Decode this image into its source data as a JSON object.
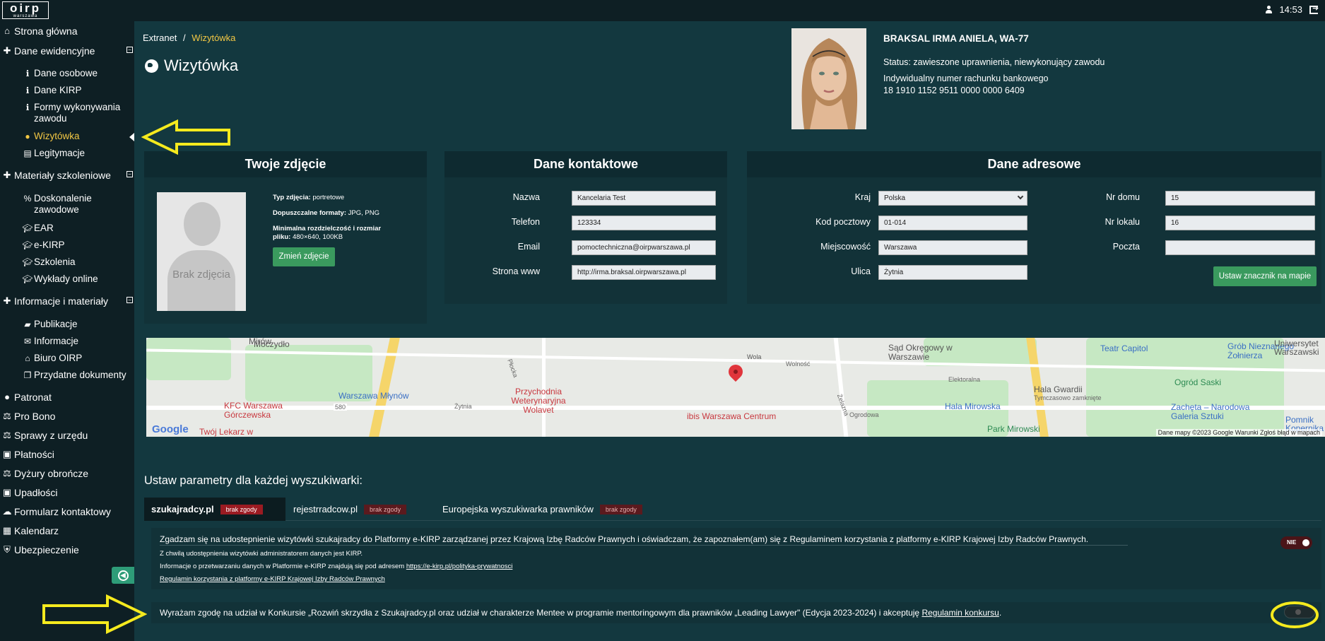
{
  "topbar": {
    "logo_big": "oirp",
    "logo_small": "warszawa",
    "time": "14:53"
  },
  "sidebar": {
    "items": [
      {
        "label": "Strona główna",
        "icon": "home-icon"
      },
      {
        "label": "Dane ewidencyjne",
        "icon": "plus-icon"
      },
      {
        "label": "Dane osobowe",
        "icon": "info-icon"
      },
      {
        "label": "Dane KIRP",
        "icon": "info-icon"
      },
      {
        "label": "Formy wykonywania zawodu",
        "icon": "info-icon"
      },
      {
        "label": "Wizytówka",
        "icon": "globe-icon"
      },
      {
        "label": "Legitymacje",
        "icon": "id-card-icon"
      },
      {
        "label": "Materiały szkoleniowe",
        "icon": "plus-icon"
      },
      {
        "label": "Doskonalenie zawodowe",
        "icon": "link-icon"
      },
      {
        "label": "EAR",
        "icon": "graduation-cap-icon"
      },
      {
        "label": "e-KIRP",
        "icon": "graduation-cap-icon"
      },
      {
        "label": "Szkolenia",
        "icon": "graduation-cap-icon"
      },
      {
        "label": "Wykłady online",
        "icon": "graduation-cap-icon"
      },
      {
        "label": "Informacje i materiały",
        "icon": "plus-icon"
      },
      {
        "label": "Publikacje",
        "icon": "book-icon"
      },
      {
        "label": "Informacje",
        "icon": "envelope-icon"
      },
      {
        "label": "Biuro OIRP",
        "icon": "bank-icon"
      },
      {
        "label": "Przydatne dokumenty",
        "icon": "documents-icon"
      },
      {
        "label": "Patronat",
        "icon": "user-icon"
      },
      {
        "label": "Pro Bono",
        "icon": "scales-icon"
      },
      {
        "label": "Sprawy z urzędu",
        "icon": "scales-icon"
      },
      {
        "label": "Płatności",
        "icon": "money-icon"
      },
      {
        "label": "Dyżury obrończe",
        "icon": "scales-icon"
      },
      {
        "label": "Upadłości",
        "icon": "money-icon"
      },
      {
        "label": "Formularz kontaktowy",
        "icon": "comments-icon"
      },
      {
        "label": "Kalendarz",
        "icon": "calendar-icon"
      },
      {
        "label": "Ubezpieczenie",
        "icon": "shield-icon"
      }
    ]
  },
  "breadcrumb": {
    "root": "Extranet",
    "separator": "/",
    "current": "Wizytówka"
  },
  "page_title": "Wizytówka",
  "profile": {
    "name": "BRAKSAL IRMA ANIELA, WA-77",
    "status": "Status: zawieszone uprawnienia, niewykonujący zawodu",
    "account_label": "Indywidualny numer rachunku bankowego",
    "account_number": "18 1910 1152 9511 0000 0000 6409"
  },
  "photo_panel": {
    "title": "Twoje zdjęcie",
    "no_photo": "Brak zdjęcia",
    "type_label": "Typ zdjęcia:",
    "type_value": "portretowe",
    "formats_label": "Dopuszczalne formaty:",
    "formats_value": "JPG, PNG",
    "min_label": "Minimalna rozdzielczość i rozmiar pliku:",
    "min_value": "480×640, 100KB",
    "button": "Zmień zdjęcie"
  },
  "contact_panel": {
    "title": "Dane kontaktowe",
    "fields": [
      {
        "label": "Nazwa",
        "value": "Kancelaria Test"
      },
      {
        "label": "Telefon",
        "value": "123334"
      },
      {
        "label": "Email",
        "value": "pomoctechniczna@oirpwarszawa.pl"
      },
      {
        "label": "Strona www",
        "value": "http://irma.braksal.oirpwarszawa.pl"
      }
    ]
  },
  "address_panel": {
    "title": "Dane adresowe",
    "country_label": "Kraj",
    "country_value": "Polska",
    "postal_label": "Kod pocztowy",
    "postal_value": "01-014",
    "city_label": "Miejscowość",
    "city_value": "Warszawa",
    "street_label": "Ulica",
    "street_value": "Żytnia",
    "house_label": "Nr domu",
    "house_value": "15",
    "flat_label": "Nr lokalu",
    "flat_value": "16",
    "post_label": "Poczta",
    "post_value": "",
    "button": "Ustaw znacznik na mapie"
  },
  "map": {
    "labels": [
      "Mirów",
      "Wola",
      "Moczydło",
      "Warszawa Młynów",
      "Przychodnia Weterynaryjna Wolavet",
      "KFC Warszawa Górczewska",
      "Twój Lekarz w",
      "ibis Warszawa Centrum",
      "Sąd Okręgowy w Warszawie",
      "Teatr Capitol",
      "Grób Nieznanego Żołnierza",
      "Hala Gwardii",
      "Tymczasowo zamknięte",
      "Hala Mirowska",
      "Ogród Saski",
      "Zachęta – Narodowa Galeria Sztuki",
      "Park Mirowski",
      "Uniwersytet Warszawski",
      "Pomnik Kopernika",
      "Żytnia",
      "Elektoralna",
      "Żelazna",
      "Płocka",
      "Ogrodowa",
      "Wolność",
      "580"
    ],
    "google": "Google",
    "footer": "Dane mapy ©2023 Google   Warunki   Zgłoś błąd w mapach"
  },
  "search": {
    "title": "Ustaw parametry dla każdej wyszukiwarki:",
    "tabs": [
      {
        "label": "szukajradcy.pl",
        "badge": "brak zgody"
      },
      {
        "label": "rejestrradcow.pl",
        "badge": "brak zgody"
      },
      {
        "label": "Europejska wyszukiwarka prawników",
        "badge": "brak zgody"
      }
    ],
    "consent1": {
      "text": "Zgadzam się na udostepnienie wizytówki szukajradcy do Platformy e-KIRP zarządzanej przez Krajową Izbę Radców Prawnych i oświadczam, że zapoznałem(am) się z Regulaminem korzystania z platformy e-KIRP Krajowej Izby Radców Prawnych.",
      "line1": "Z chwilą udostępnienia wizytówki administratorem danych jest KIRP.",
      "line2_prefix": "Informacje o przetwarzaniu danych w Platformie e-KIRP znajdują się pod adresem",
      "line2_link": "https://e-kirp.pl/polityka-prywatnosci",
      "line3_link": "Regulamin korzystania z platformy e-KIRP Krajowej Izby Radców Prawnych",
      "toggle": "NIE"
    },
    "consent2": {
      "text": "Wyrażam zgodę na udział w Konkursie „Rozwiń skrzydła z Szukajradcy.pl oraz udział w charakterze Mentee w programie mentoringowym dla prawników „Leading Lawyer\" (Edycja 2023-2024) i akceptuję",
      "link": "Regulamin konkursu",
      "end": "."
    }
  }
}
